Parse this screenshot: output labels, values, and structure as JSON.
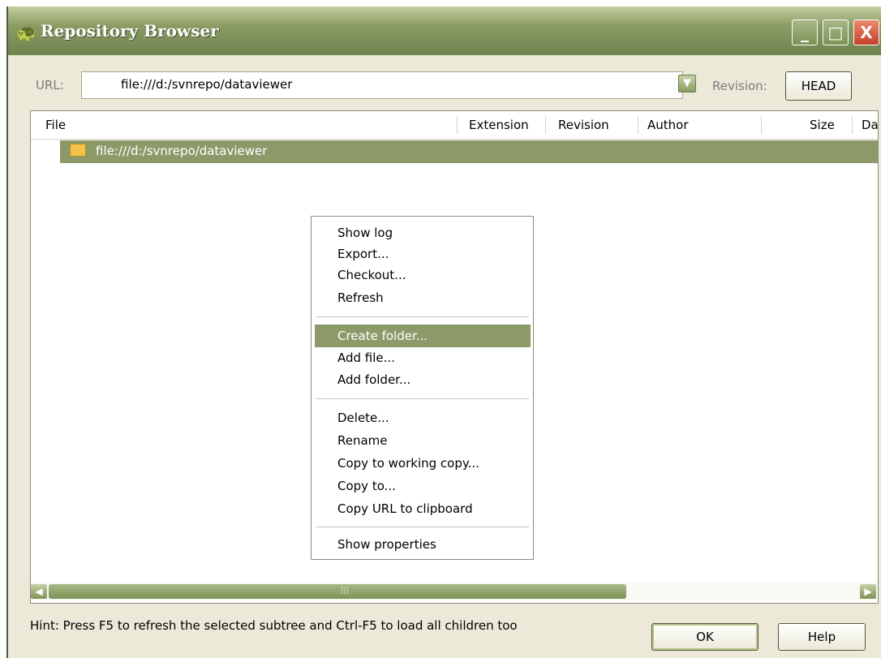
{
  "window": {
    "title": "Repository Browser"
  },
  "title_buttons": {
    "minimize": "_",
    "maximize": "□",
    "close": "X"
  },
  "url": {
    "label": "URL:",
    "value": "file:///d:/svnrepo/dataviewer"
  },
  "revision": {
    "label": "Revision:",
    "value": "HEAD"
  },
  "columns": [
    "File",
    "Extension",
    "Revision",
    "Author",
    "Size",
    "Da"
  ],
  "tree": {
    "root_label": "file:///d:/svnrepo/dataviewer"
  },
  "context_menu": {
    "items": [
      "Show log",
      "Export...",
      "Checkout...",
      "Refresh",
      "Create folder...",
      "Add file...",
      "Add folder...",
      "Delete...",
      "Rename",
      "Copy to working copy...",
      "Copy to...",
      "Copy URL to clipboard",
      "Show properties"
    ],
    "highlighted": "Create folder..."
  },
  "hint": {
    "text": "Hint: Press F5 to refresh the selected subtree and Ctrl-F5 to load all children too"
  },
  "buttons": {
    "ok": "OK",
    "help": "Help"
  },
  "colors": {
    "title_bar": "#8a9c62",
    "selection": "#8c9a6a",
    "dialog_bg": "#ece9d8"
  }
}
